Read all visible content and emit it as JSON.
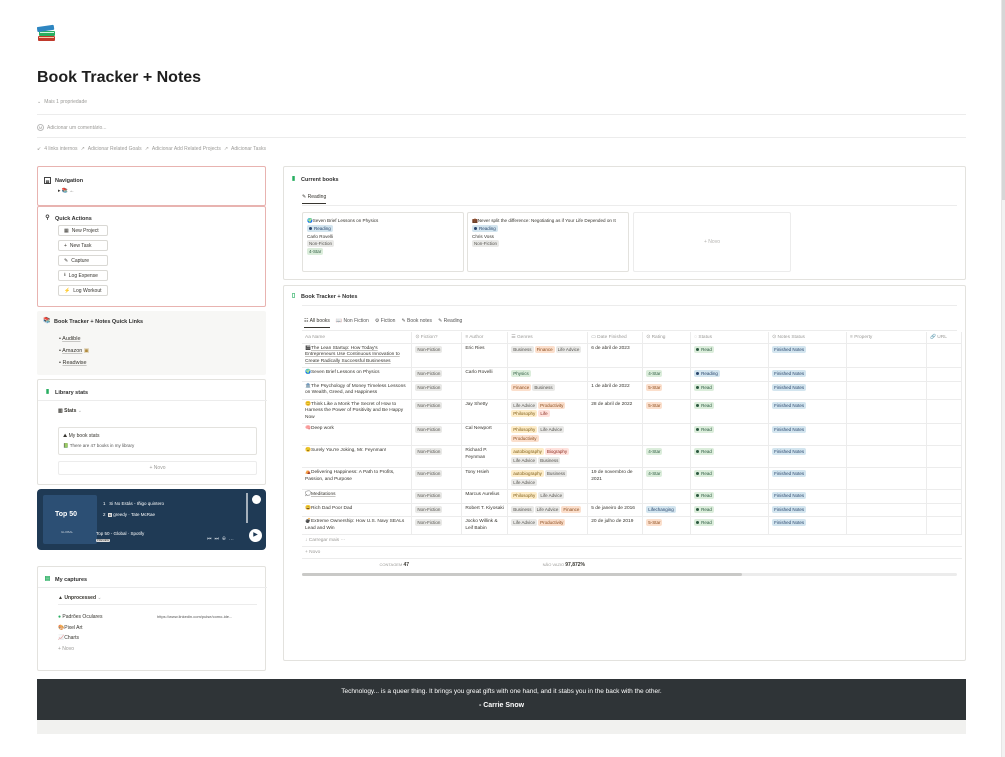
{
  "page": {
    "title": "Book Tracker + Notes",
    "icon": "books-icon"
  },
  "meta": {
    "more_props": "Mais 1 propriedade",
    "add_comment": "Adicionar um comentário...",
    "links": [
      "4 links internos",
      "Adicionar Related Goals",
      "Adicionar Add Related Projects",
      "Adicionar Tasks"
    ]
  },
  "navigation": {
    "title": "Navigation",
    "item": "📚 ←"
  },
  "quick_actions": {
    "title": "Quick Actions",
    "buttons": [
      "New Project",
      "New Task",
      "Capture",
      "Log Expense",
      "Log Workout"
    ]
  },
  "quick_links": {
    "title": "Book Tracker + Notes Quick Links",
    "items": [
      "Audible",
      "Amazon",
      "Readwise"
    ]
  },
  "library_stats": {
    "title": "Library stats",
    "view": "Stats",
    "card_title": "My book stats",
    "card_text": "There are 47 books in my library",
    "new": "+ Novo"
  },
  "spotify": {
    "cover_title": "Top 50",
    "cover_sub": "GLOBAL",
    "tracks": [
      "Si No Estás - Iñigo quintero",
      "greedy · Tate McRae"
    ],
    "playlist": "Top 50 - Global · Spotify",
    "badge": "PREVIEW"
  },
  "captures": {
    "title": "My captures",
    "view": "Unprocessed",
    "items": [
      {
        "name": "Padrões Oculares",
        "url": "https://www.linkedin.com/pulse/como-ide..."
      },
      {
        "name": "Pixel Art",
        "url": ""
      },
      {
        "name": "Charts",
        "url": ""
      }
    ],
    "new": "+ Novo"
  },
  "current_books": {
    "title": "Current books",
    "tab": "Reading",
    "cards": [
      {
        "title": "Seven Brief Lessons on Physics",
        "status": "Reading",
        "author": "Carlo Rovelli",
        "fiction": "Non-Fiction",
        "rating": "4-Star"
      },
      {
        "title": "Never split the difference: Negotiating as if Your Life Depended on It",
        "status": "Reading",
        "author": "Chris Voss",
        "fiction": "Non-Fiction",
        "rating": ""
      }
    ],
    "new": "+ Novo"
  },
  "tracker": {
    "title": "Book Tracker + Notes",
    "tabs": [
      "All books",
      "Non Fiction",
      "Fiction",
      "Book notes",
      "Reading"
    ],
    "columns": [
      "Name",
      "Fiction?",
      "Author",
      "Genres",
      "Date Finished",
      "Rating",
      "Status",
      "Notes Status",
      "Property",
      "URL"
    ],
    "rows": [
      {
        "name": "The Lean Startup: How Today's Entrepreneurs Use Continuous Innovation to Create Radically Successful Businesses",
        "fiction": "Non-Fiction",
        "author": "Eric Ries",
        "genres": [
          "Business",
          "Finance",
          "Life Advice"
        ],
        "date": "6 de abril de 2023",
        "rating": "",
        "status": "Read",
        "notes": "Finished Notes"
      },
      {
        "name": "Seven Brief Lessons on Physics",
        "fiction": "Non-Fiction",
        "author": "Carlo Rovelli",
        "genres": [
          "Physics"
        ],
        "date": "",
        "rating": "4-Star",
        "status": "Reading",
        "notes": "Finished Notes"
      },
      {
        "name": "The Psychology of Money Timeless Lessons on Wealth, Greed, and Happiness",
        "fiction": "Non-Fiction",
        "author": "",
        "genres": [
          "Finance",
          "Business"
        ],
        "date": "1 de abril de 2022",
        "rating": "5-Star",
        "status": "Read",
        "notes": "Finished Notes"
      },
      {
        "name": "Think Like a Monk The Secret of How to Harness the Power of Positivity and Be Happy Now",
        "fiction": "Non-Fiction",
        "author": "Jay Shetty",
        "genres": [
          "Life Advice",
          "Productivity",
          "Philosophy",
          "Life"
        ],
        "date": "28 de abril de 2022",
        "rating": "5-Star",
        "status": "Read",
        "notes": "Finished Notes"
      },
      {
        "name": "Deep work",
        "fiction": "Non-Fiction",
        "author": "Cal Newport",
        "genres": [
          "Philosophy",
          "Life Advice",
          "Productivity"
        ],
        "date": "",
        "rating": "",
        "status": "Read",
        "notes": "Finished Notes"
      },
      {
        "name": "Surely You're Joking, Mr. Feynman!",
        "fiction": "Non-Fiction",
        "author": "Richard P. Feynman",
        "genres": [
          "autobiography",
          "Biography",
          "Life Advice",
          "Business"
        ],
        "date": "",
        "rating": "4-Star",
        "status": "Read",
        "notes": "Finished Notes"
      },
      {
        "name": "Delivering Happiness: A Path to Profits, Passion, and Purpose",
        "fiction": "Non-Fiction",
        "author": "Tony Hsieh",
        "genres": [
          "autobiography",
          "Business",
          "Life Advice"
        ],
        "date": "19 de novembro de 2021",
        "rating": "4-Star",
        "status": "Read",
        "notes": "Finished Notes"
      },
      {
        "name": "Meditations",
        "fiction": "Non-Fiction",
        "author": "Marcus Aurelius",
        "genres": [
          "Philosophy",
          "Life Advice"
        ],
        "date": "",
        "rating": "",
        "status": "Read",
        "notes": "Finished Notes"
      },
      {
        "name": "Rich Dad Poor Dad",
        "fiction": "Non-Fiction",
        "author": "Robert T. Kiyosaki",
        "genres": [
          "Business",
          "Life Advice",
          "Finance"
        ],
        "date": "5 de janeiro de 2016",
        "rating": "Lifechanging",
        "status": "Read",
        "notes": "Finished Notes"
      },
      {
        "name": "Extreme Ownership: How U.S. Navy SEALs Lead and Win",
        "fiction": "Non-Fiction",
        "author": "Jocko Willink & Leif Babin",
        "genres": [
          "Life Advice",
          "Productivity"
        ],
        "date": "20 de julho de 2019",
        "rating": "5-Star",
        "status": "Read",
        "notes": "Finished Notes"
      }
    ],
    "load_more": "Carregar mais",
    "new": "+ Novo",
    "count_label": "CONTAGEM",
    "count_value": "47",
    "notempty_label": "NÃO VAZIO",
    "notempty_value": "97,872%"
  },
  "quote": {
    "text": "Technology... is a queer thing. It brings you great gifts with one hand, and it stabs you in the back with the other.",
    "author": "- Carrie Snow"
  }
}
